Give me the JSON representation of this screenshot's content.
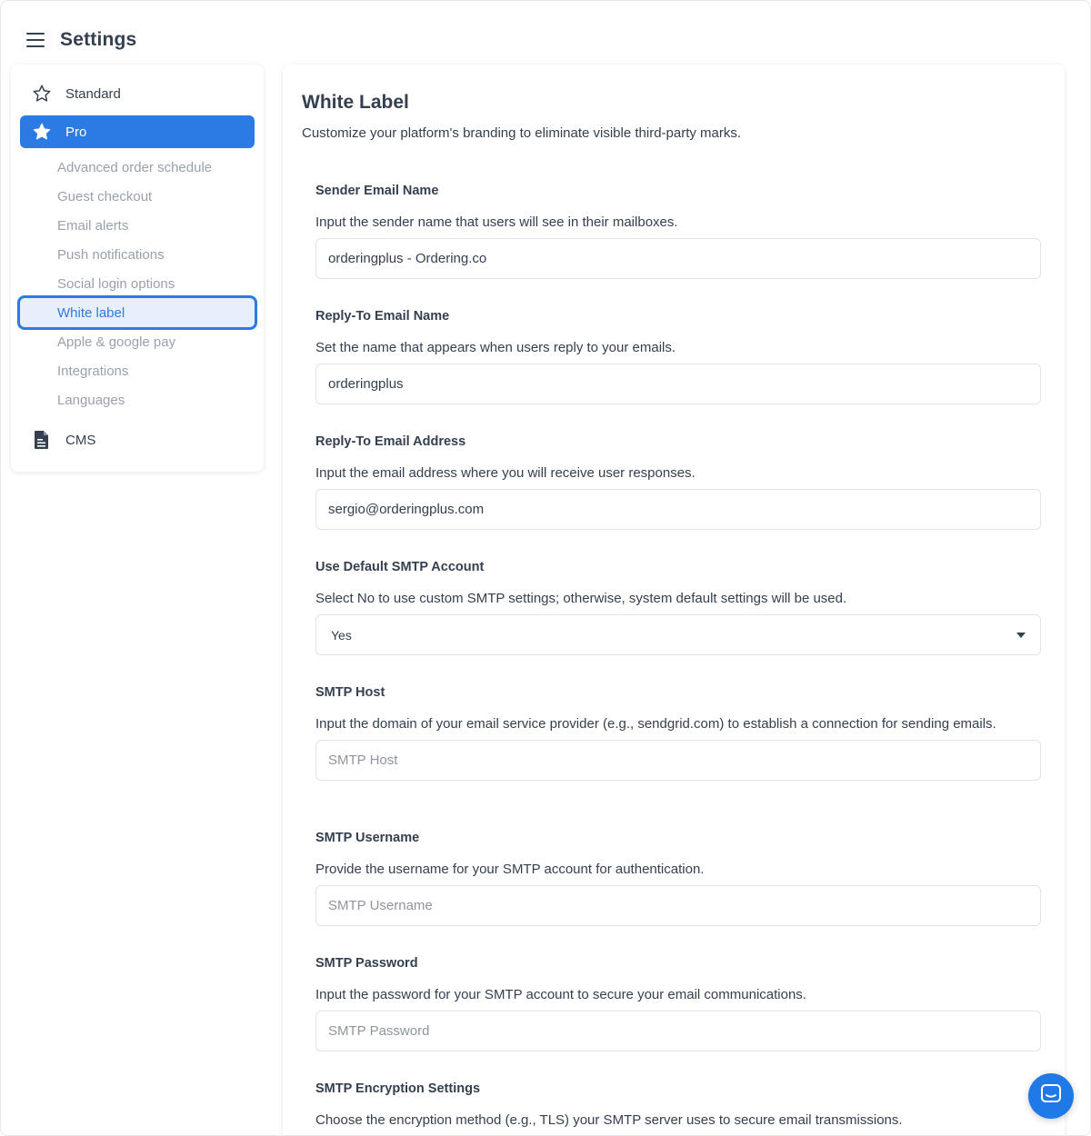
{
  "header": {
    "title": "Settings"
  },
  "sidebar": {
    "standard_label": "Standard",
    "pro_label": "Pro",
    "pro_items": [
      "Advanced order schedule",
      "Guest checkout",
      "Email alerts",
      "Push notifications",
      "Social login options",
      "White label",
      "Apple & google pay",
      "Integrations",
      "Languages"
    ],
    "cms_label": "CMS"
  },
  "main": {
    "title": "White Label",
    "description": "Customize your platform's branding to eliminate visible third-party marks.",
    "fields": [
      {
        "label": "Sender Email Name",
        "help": "Input the sender name that users will see in their mailboxes.",
        "value": "orderingplus - Ordering.co",
        "placeholder": ""
      },
      {
        "label": "Reply-To Email Name",
        "help": "Set the name that appears when users reply to your emails.",
        "value": "orderingplus",
        "placeholder": ""
      },
      {
        "label": "Reply-To Email Address",
        "help": "Input the email address where you will receive user responses.",
        "value": "sergio@orderingplus.com",
        "placeholder": ""
      },
      {
        "label": "Use Default SMTP Account",
        "help": "Select No to use custom SMTP settings; otherwise, system default settings will be used.",
        "selected": "Yes"
      },
      {
        "label": "SMTP Host",
        "help": "Input the domain of your email service provider (e.g., sendgrid.com) to establish a connection for sending emails.",
        "value": "",
        "placeholder": "SMTP Host"
      },
      {
        "label": "SMTP Username",
        "help": "Provide the username for your SMTP account for authentication.",
        "value": "",
        "placeholder": "SMTP Username"
      },
      {
        "label": "SMTP Password",
        "help": "Input the password for your SMTP account to secure your email communications.",
        "value": "",
        "placeholder": "SMTP Password"
      },
      {
        "label": "SMTP Encryption Settings",
        "help": "Choose the encryption method (e.g., TLS) your SMTP server uses to secure email transmissions."
      }
    ]
  },
  "colors": {
    "accent": "#2c7be5",
    "text": "#344050",
    "muted": "#9aa1ac",
    "chat": "#1f7ae8"
  }
}
